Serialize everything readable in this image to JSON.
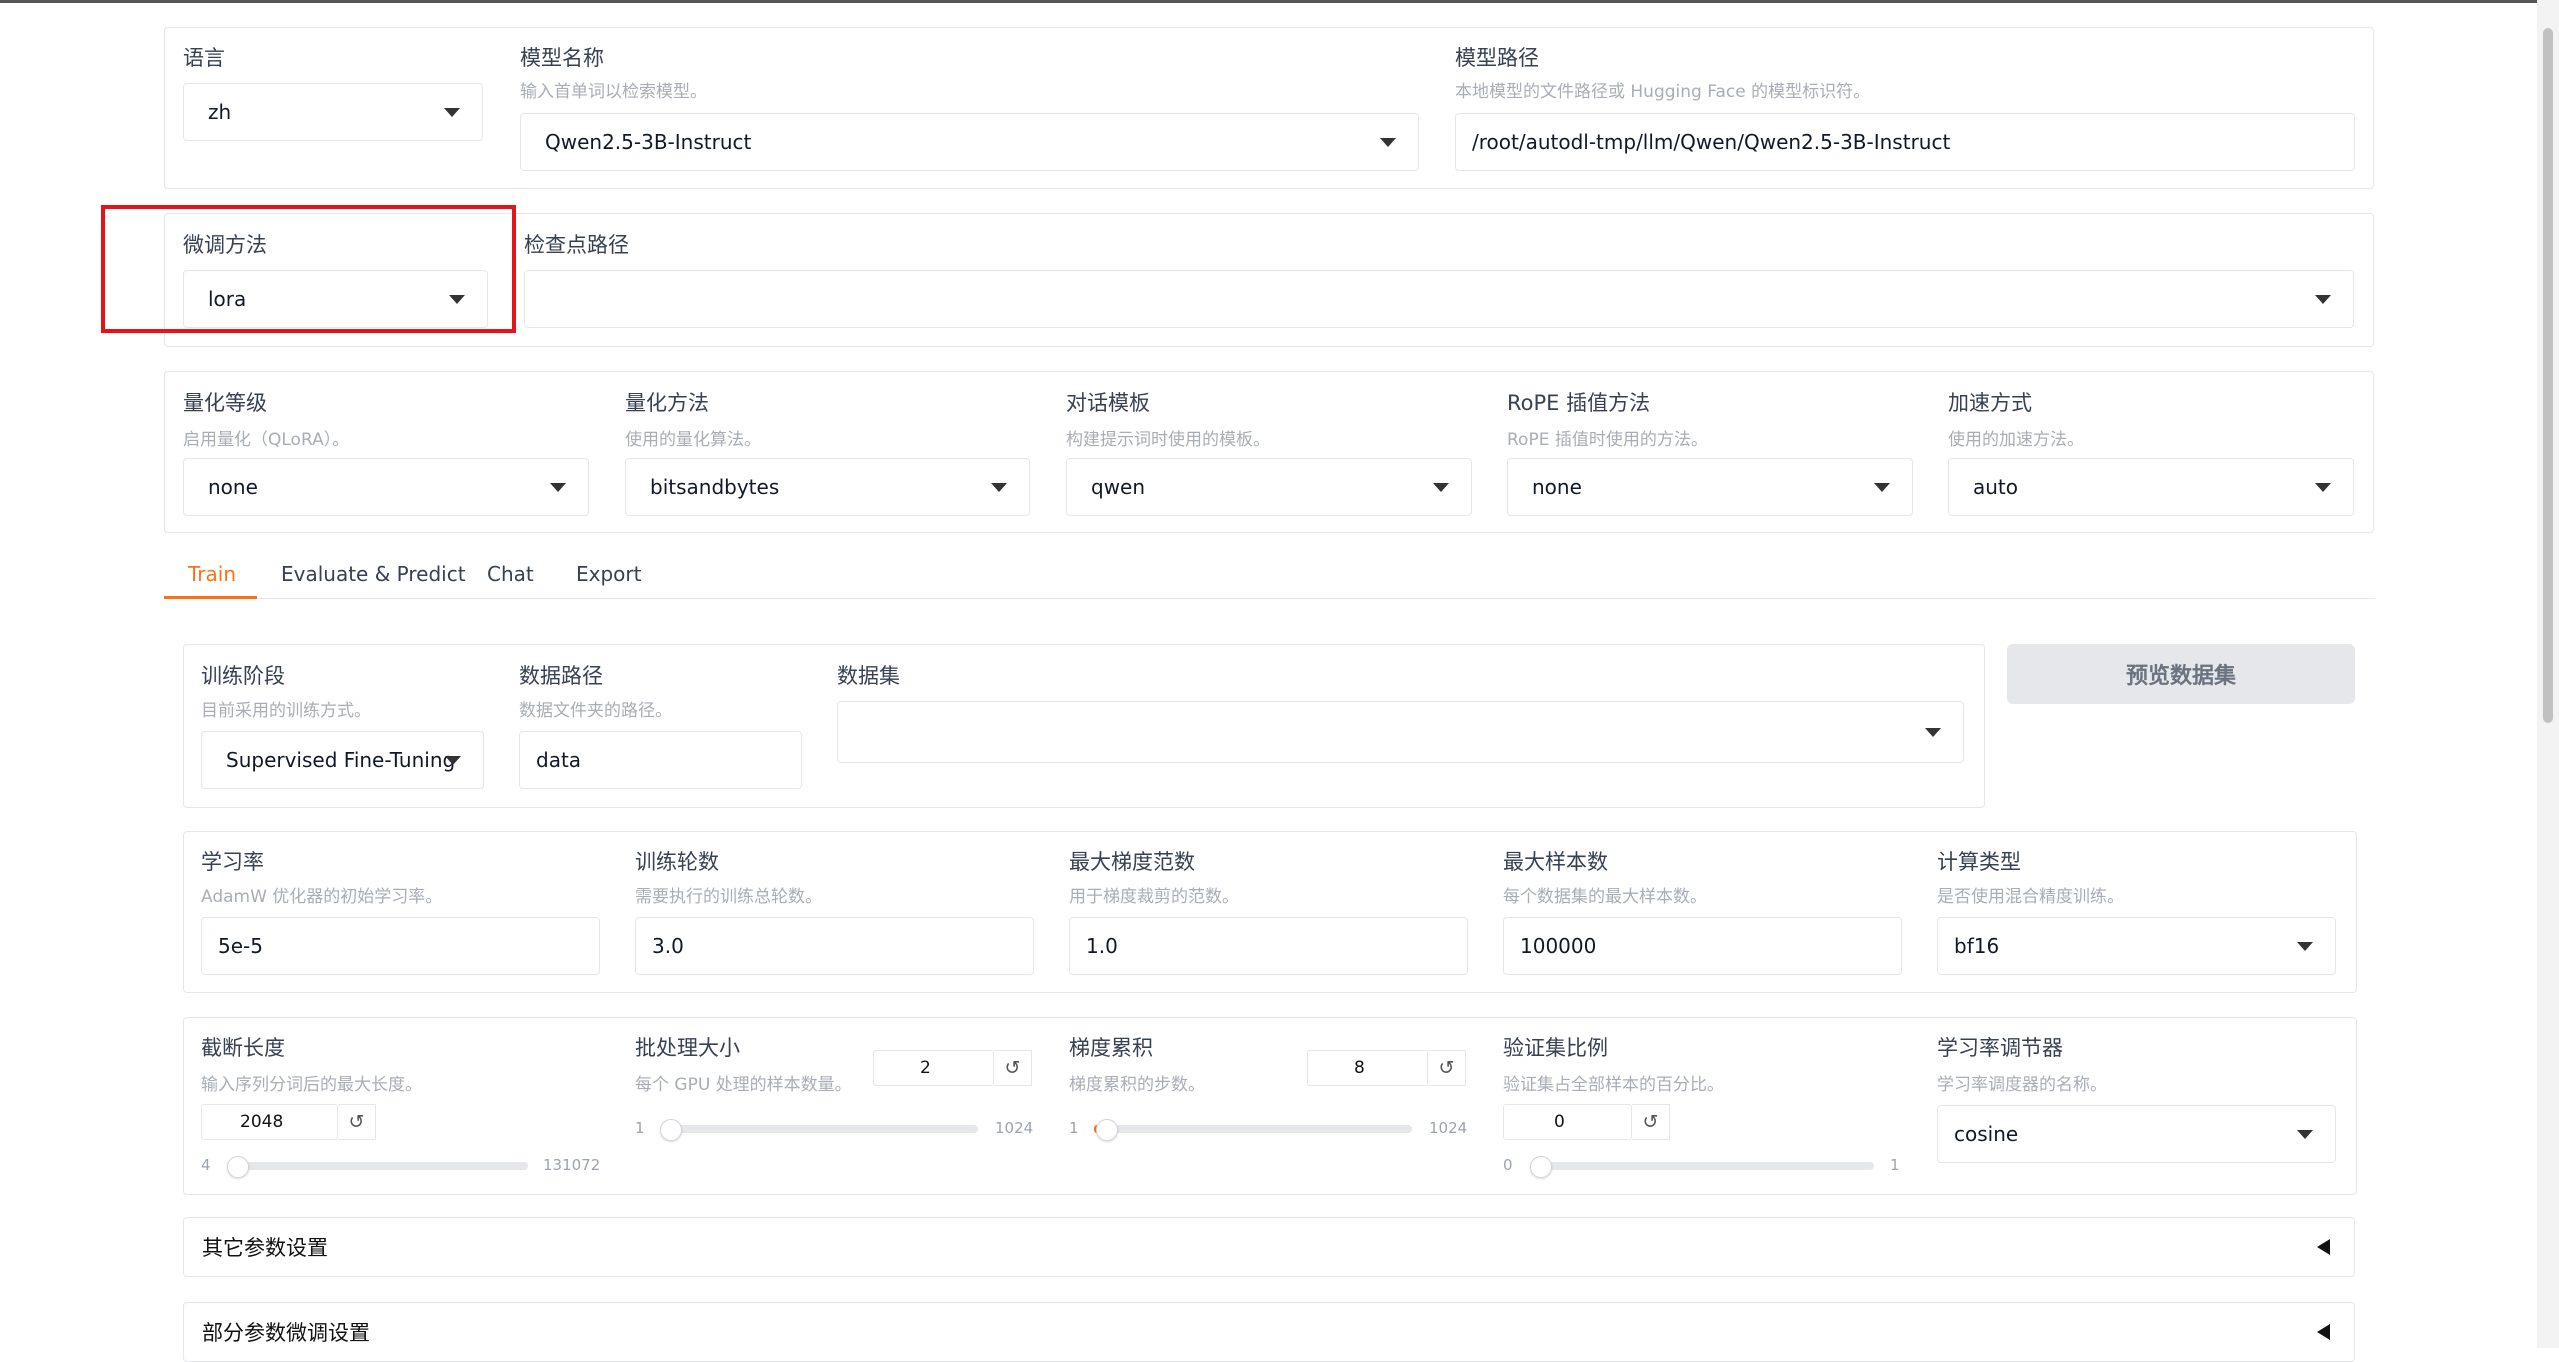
{
  "top": {
    "language": {
      "label": "语言",
      "value": "zh"
    },
    "model_name": {
      "label": "模型名称",
      "info": "输入首单词以检索模型。",
      "value": "Qwen2.5-3B-Instruct"
    },
    "model_path": {
      "label": "模型路径",
      "info": "本地模型的文件路径或 Hugging Face 的模型标识符。",
      "value": "/root/autodl-tmp/llm/Qwen/Qwen2.5-3B-Instruct"
    }
  },
  "finetune": {
    "method": {
      "label": "微调方法",
      "value": "lora"
    },
    "checkpoint": {
      "label": "检查点路径",
      "value": ""
    }
  },
  "advanced": {
    "quant_bit": {
      "label": "量化等级",
      "info": "启用量化（QLoRA）。",
      "value": "none"
    },
    "quant_method": {
      "label": "量化方法",
      "info": "使用的量化算法。",
      "value": "bitsandbytes"
    },
    "template": {
      "label": "对话模板",
      "info": "构建提示词时使用的模板。",
      "value": "qwen"
    },
    "rope": {
      "label": "RoPE 插值方法",
      "info": "RoPE 插值时使用的方法。",
      "value": "none"
    },
    "booster": {
      "label": "加速方式",
      "info": "使用的加速方法。",
      "value": "auto"
    }
  },
  "tabs": [
    "Train",
    "Evaluate & Predict",
    "Chat",
    "Export"
  ],
  "train": {
    "stage": {
      "label": "训练阶段",
      "info": "目前采用的训练方式。",
      "value": "Supervised Fine-Tuning"
    },
    "dataset_dir": {
      "label": "数据路径",
      "info": "数据文件夹的路径。",
      "value": "data"
    },
    "dataset": {
      "label": "数据集",
      "value": ""
    },
    "preview_button": "预览数据集",
    "learning_rate": {
      "label": "学习率",
      "info": "AdamW 优化器的初始学习率。",
      "value": "5e-5"
    },
    "epochs": {
      "label": "训练轮数",
      "info": "需要执行的训练总轮数。",
      "value": "3.0"
    },
    "max_grad_norm": {
      "label": "最大梯度范数",
      "info": "用于梯度裁剪的范数。",
      "value": "1.0"
    },
    "max_samples": {
      "label": "最大样本数",
      "info": "每个数据集的最大样本数。",
      "value": "100000"
    },
    "compute_type": {
      "label": "计算类型",
      "info": "是否使用混合精度训练。",
      "value": "bf16"
    },
    "cutoff_len": {
      "label": "截断长度",
      "info": "输入序列分词后的最大长度。",
      "value": "2048",
      "min": "4",
      "max": "131072",
      "fraction": 0.0156
    },
    "batch_size": {
      "label": "批处理大小",
      "info": "每个 GPU 处理的样本数量。",
      "value": "2",
      "min": "1",
      "max": "1024",
      "fraction": 0.001
    },
    "grad_accum": {
      "label": "梯度累积",
      "info": "梯度累积的步数。",
      "value": "8",
      "min": "1",
      "max": "1024",
      "fraction": 0.007
    },
    "val_size": {
      "label": "验证集比例",
      "info": "验证集占全部样本的百分比。",
      "value": "0",
      "min": "0",
      "max": "1",
      "fraction": 0
    },
    "lr_scheduler": {
      "label": "学习率调节器",
      "info": "学习率调度器的名称。",
      "value": "cosine"
    },
    "extra_accordion": "其它参数设置",
    "freeze_accordion": "部分参数微调设置"
  },
  "icons": {
    "reset": "↺"
  }
}
